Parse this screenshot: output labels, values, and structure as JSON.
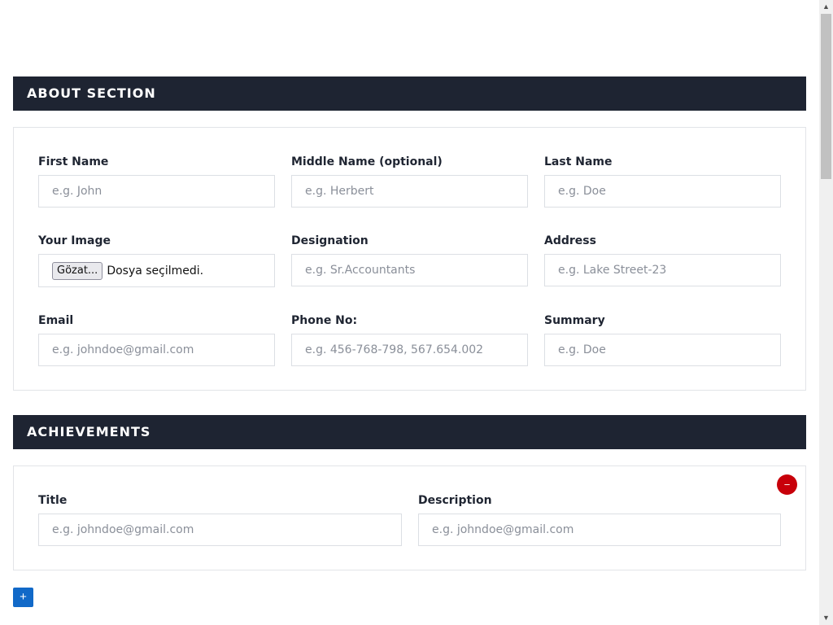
{
  "about": {
    "title": "ABOUT SECTION",
    "fields": {
      "first_name": {
        "label": "First Name",
        "placeholder": "e.g. John"
      },
      "middle_name": {
        "label": "Middle Name (optional)",
        "placeholder": "e.g. Herbert"
      },
      "last_name": {
        "label": "Last Name",
        "placeholder": "e.g. Doe"
      },
      "image": {
        "label": "Your Image",
        "button": "Gözat...",
        "status": "Dosya seçilmedi."
      },
      "designation": {
        "label": "Designation",
        "placeholder": "e.g. Sr.Accountants"
      },
      "address": {
        "label": "Address",
        "placeholder": "e.g. Lake Street-23"
      },
      "email": {
        "label": "Email",
        "placeholder": "e.g. johndoe@gmail.com"
      },
      "phone": {
        "label": "Phone No:",
        "placeholder": "e.g. 456-768-798, 567.654.002"
      },
      "summary": {
        "label": "Summary",
        "placeholder": "e.g. Doe"
      }
    }
  },
  "achievements": {
    "title": "ACHIEVEMENTS",
    "remove_label": "−",
    "fields": {
      "title": {
        "label": "Title",
        "placeholder": "e.g. johndoe@gmail.com"
      },
      "description": {
        "label": "Description",
        "placeholder": "e.g. johndoe@gmail.com"
      }
    },
    "add_label": "+"
  },
  "colors": {
    "header_bg": "#1e2432",
    "remove_button": "#c8000a",
    "add_button": "#1169c8"
  },
  "icons": {
    "scroll_up": "triangle-up",
    "scroll_down": "triangle-down"
  }
}
